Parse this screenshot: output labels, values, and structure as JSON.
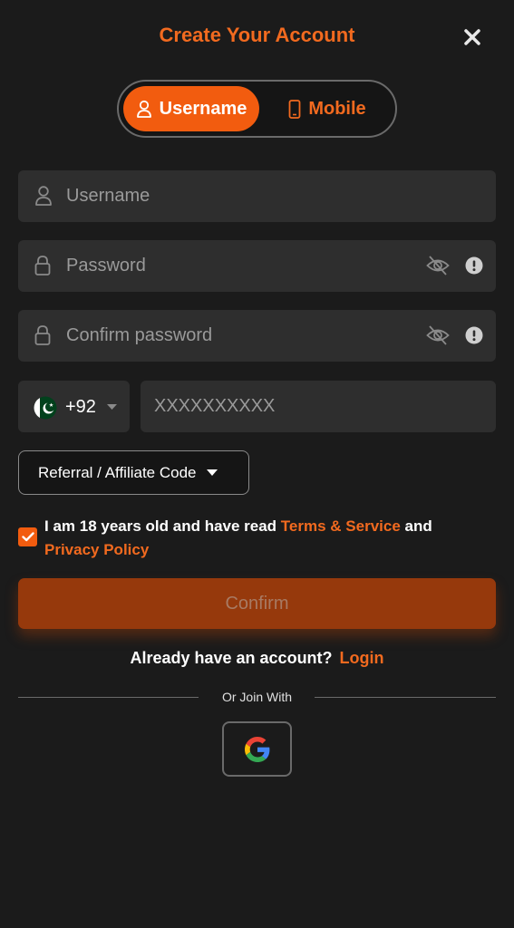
{
  "header": {
    "title": "Create Your Account",
    "close_icon": "close-icon"
  },
  "mode_toggle": {
    "username_label": "Username",
    "mobile_label": "Mobile",
    "active": "Username",
    "accent_color": "#f25c0f"
  },
  "form": {
    "username_placeholder": "Username",
    "password_placeholder": "Password",
    "confirm_password_placeholder": "Confirm password",
    "country_code": "+92",
    "phone_placeholder": "XXXXXXXXXX",
    "referral_label": "Referral / Affiliate Code"
  },
  "agreement": {
    "checked": true,
    "text_before": "I am 18 years old and have read ",
    "terms_link": "Terms & Service",
    "text_and": " and ",
    "privacy_link": "Privacy Policy"
  },
  "confirm_label": "Confirm",
  "footer": {
    "have_account": "Already have an account?",
    "login_link": "Login",
    "or_join_with": "Or Join With",
    "social": [
      "google-icon"
    ]
  }
}
